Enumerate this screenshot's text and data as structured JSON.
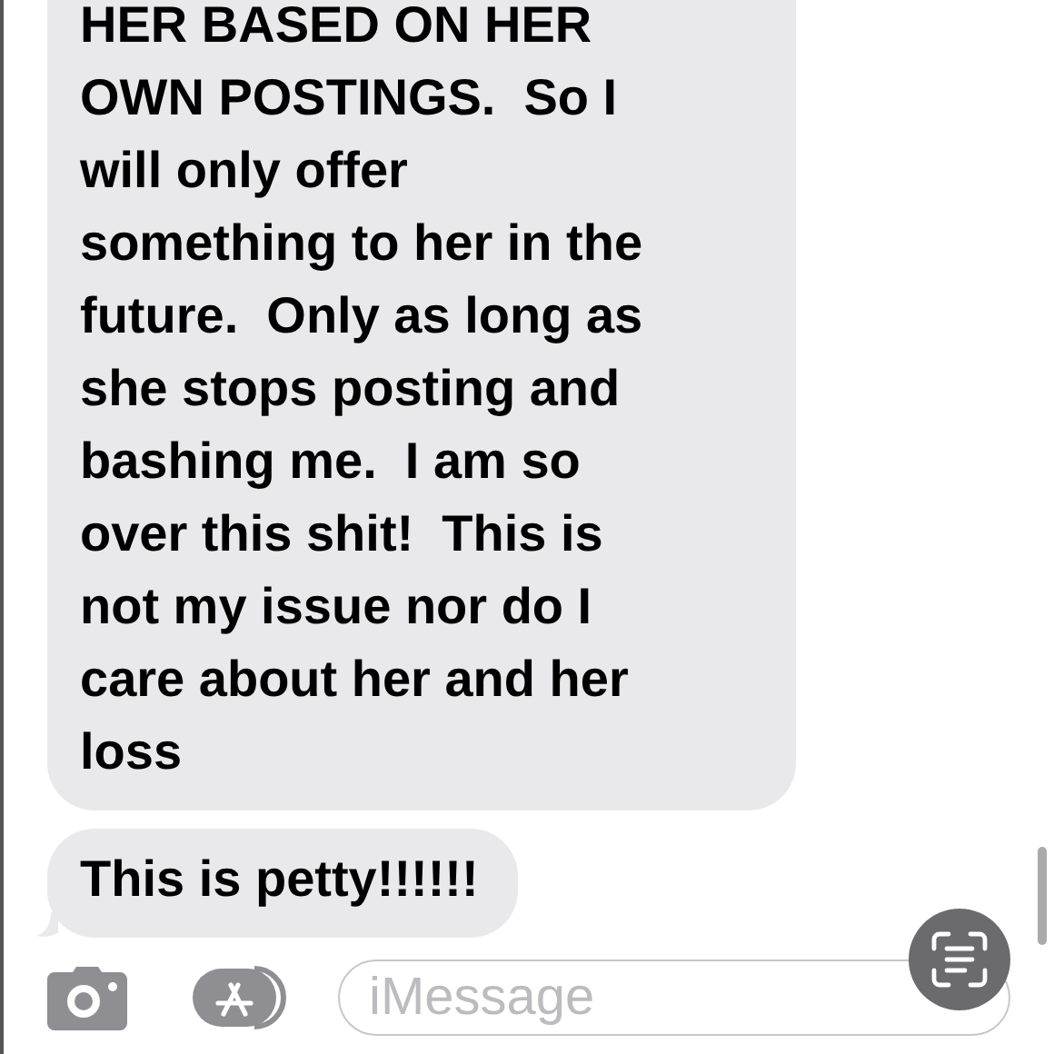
{
  "messages": [
    {
      "lines": [
        "HER BASED ON HER",
        "OWN POSTINGS.  So I",
        "will only offer",
        "something to her in the",
        "future.  Only as long as",
        "she stops posting and",
        "bashing me.  I am so",
        "over this shit!  This is",
        "not my issue nor do I",
        "care about her and her",
        "loss"
      ],
      "tail": false
    },
    {
      "lines": [
        "This is petty!!!!!!"
      ],
      "tail": true
    }
  ],
  "composer": {
    "placeholder": "iMessage"
  }
}
